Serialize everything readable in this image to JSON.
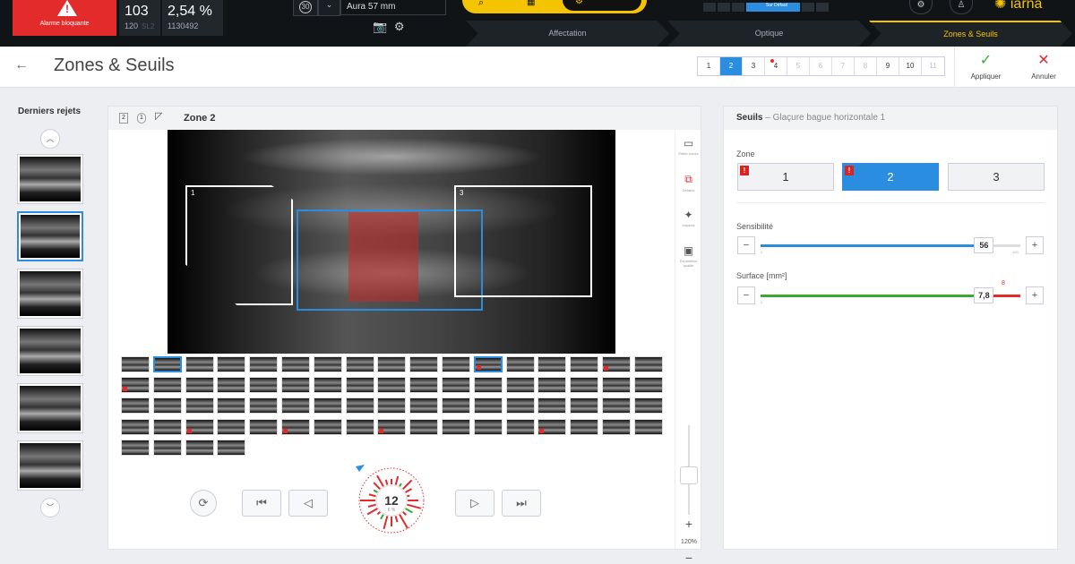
{
  "topbar": {
    "alarm_label": "Alarme bloquante",
    "count_main": "103",
    "count_sub": "120",
    "count_sub_dim": "SL2",
    "percent": "2,54 %",
    "percent_sub": "1130492",
    "speed_icon": "30",
    "model": "Aura 57 mm",
    "preset_label": "Sur Défaut",
    "brand": "iarna"
  },
  "steps": [
    {
      "label": "Affectation"
    },
    {
      "label": "Optique"
    },
    {
      "label": "Zones & Seuils"
    }
  ],
  "header": {
    "title": "Zones & Seuils",
    "camera_tabs": [
      "1",
      "2",
      "3",
      "4",
      "5",
      "6",
      "7",
      "8",
      "9",
      "10",
      "11"
    ],
    "apply_label": "Appliquer",
    "cancel_label": "Annuler"
  },
  "left": {
    "title": "Derniers rejets"
  },
  "center": {
    "mini_a": "2",
    "mini_b": "1",
    "zone_title": "Zone 2",
    "zone_labels": [
      "1",
      "2",
      "3"
    ],
    "tools": [
      {
        "caption": "Éditer zones"
      },
      {
        "caption": "Défauts"
      },
      {
        "caption": "Impacts"
      },
      {
        "caption": "Échantillon qualité"
      }
    ],
    "zoom": "120%",
    "counter": "12",
    "counter_sub": "6 %"
  },
  "right": {
    "title": "Seuils",
    "subtitle": "Glaçure bague horizontale 1",
    "zone_label": "Zone",
    "zones": [
      "1",
      "2",
      "3"
    ],
    "selected_zone": "2",
    "sensibility_label": "Sensibilité",
    "sensibility_value": "56",
    "sensibility_min": "0",
    "sensibility_max": "100",
    "sensibility_fraction": 0.86,
    "surface_label": "Surface [mm²]",
    "surface_value": "7,8",
    "surface_min": "0",
    "surface_limit": "8",
    "surface_fraction": 0.86
  },
  "colors": {
    "accent": "#2b8de0",
    "alarm": "#e32b2b",
    "brand": "#f5c400",
    "green": "#3aaa35"
  }
}
